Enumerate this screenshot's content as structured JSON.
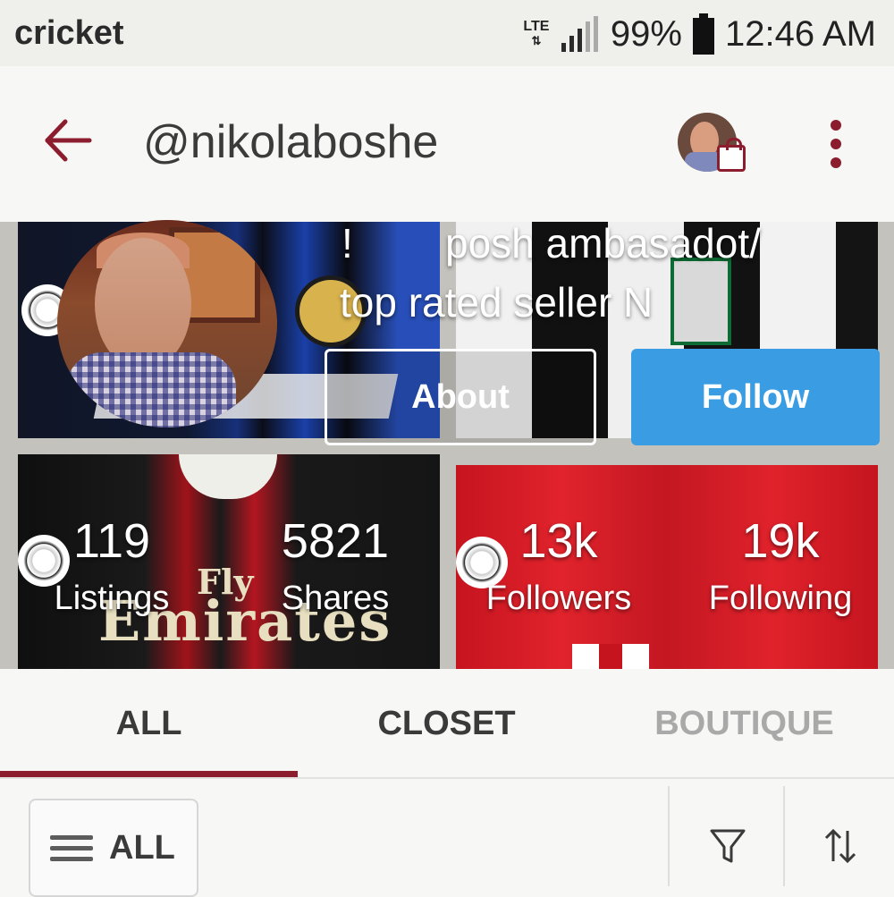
{
  "status_bar": {
    "carrier": "cricket",
    "network": "LTE",
    "battery_percent": "99%",
    "time": "12:46 AM",
    "icons": [
      "lte-icon",
      "signal-icon",
      "battery-icon"
    ]
  },
  "app_bar": {
    "title": "@nikolaboshe",
    "back_icon": "arrow-left-icon",
    "menu_icon": "more-vert-icon",
    "accent_color": "#8c1d2e"
  },
  "profile": {
    "bio_line1_prefix": "!",
    "bio_line1": "posh ambasadot/",
    "bio_line2": "top rated seller N",
    "about_label": "About",
    "follow_label": "Follow",
    "follow_color": "#3a9de3",
    "stats": [
      {
        "value": "119",
        "label": "Listings"
      },
      {
        "value": "5821",
        "label": "Shares"
      },
      {
        "value": "13k",
        "label": "Followers"
      },
      {
        "value": "19k",
        "label": "Following"
      }
    ]
  },
  "tabs": [
    {
      "label": "ALL",
      "active": true
    },
    {
      "label": "CLOSET",
      "active": false
    },
    {
      "label": "BOUTIQUE",
      "active": false
    }
  ],
  "filter_bar": {
    "filter_label": "ALL",
    "icons": [
      "menu-icon",
      "filter-funnel-icon",
      "sort-icon"
    ]
  },
  "cover_tiles": {
    "milan_sponsor_top": "Fly",
    "milan_sponsor_bottom": "Emirates"
  }
}
